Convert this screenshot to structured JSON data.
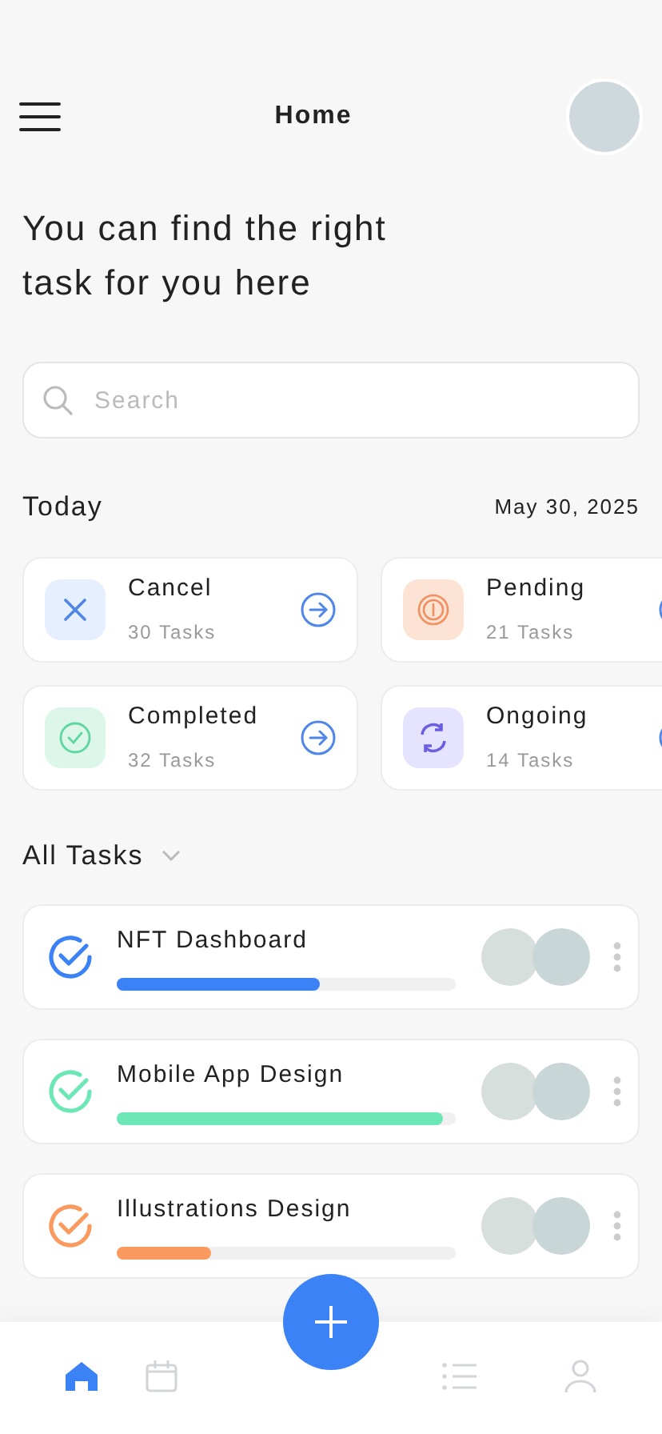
{
  "header": {
    "title": "Home"
  },
  "headline": "You can find the right task for you here",
  "search": {
    "placeholder": "Search"
  },
  "today": {
    "label": "Today",
    "date": "May 30, 2025"
  },
  "status_cards": [
    {
      "kind": "cancel",
      "title": "Cancel",
      "count": "30 Tasks"
    },
    {
      "kind": "pending",
      "title": "Pending",
      "count": "21 Tasks"
    },
    {
      "kind": "completed",
      "title": "Completed",
      "count": "32 Tasks"
    },
    {
      "kind": "ongoing",
      "title": "Ongoing",
      "count": "14 Tasks"
    }
  ],
  "all_tasks": {
    "label": "All Tasks",
    "expanded": false
  },
  "tasks": [
    {
      "name": "NFT Dashboard",
      "color": "#3b82f6",
      "level": 0.6
    },
    {
      "name": "Mobile App Design",
      "color": "#6ee7b7",
      "level": 0.96
    },
    {
      "name": "Illustrations Design",
      "color": "#fb9a5f",
      "level": 0.28
    }
  ],
  "nav": [
    {
      "kind": "home",
      "selected": true
    },
    {
      "kind": "calendar",
      "selected": false
    },
    {
      "kind": "list",
      "selected": false
    },
    {
      "kind": "profile",
      "selected": false
    }
  ]
}
